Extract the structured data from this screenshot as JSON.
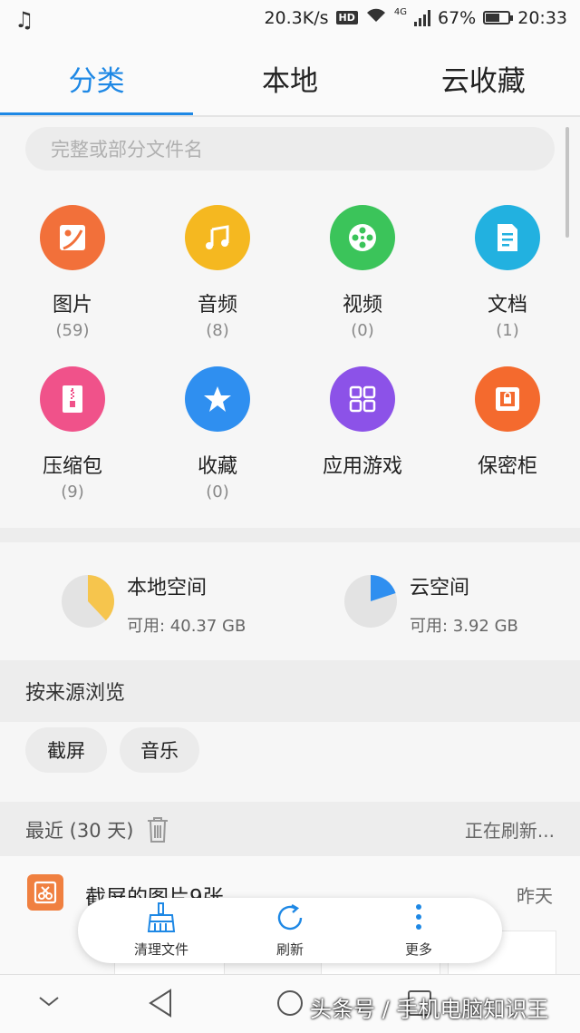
{
  "status_bar": {
    "speed": "20.3K/s",
    "hd": "HD",
    "network": "4G",
    "battery_pct": "67%",
    "battery_level": 0.67,
    "time": "20:33",
    "music_icon": "music-note-icon"
  },
  "tabs": [
    {
      "label": "分类",
      "active": true
    },
    {
      "label": "本地",
      "active": false
    },
    {
      "label": "云收藏",
      "active": false
    }
  ],
  "search": {
    "placeholder": "完整或部分文件名"
  },
  "categories": [
    {
      "label": "图片",
      "count": "(59)",
      "color": "#f2703a",
      "icon": "image-icon"
    },
    {
      "label": "音频",
      "count": "(8)",
      "color": "#f5b820",
      "icon": "music-icon"
    },
    {
      "label": "视频",
      "count": "(0)",
      "color": "#3bc45a",
      "icon": "film-reel-icon"
    },
    {
      "label": "文档",
      "count": "(1)",
      "color": "#22b1e0",
      "icon": "document-icon"
    },
    {
      "label": "压缩包",
      "count": "(9)",
      "color": "#f0528a",
      "icon": "zip-icon"
    },
    {
      "label": "收藏",
      "count": "(0)",
      "color": "#2f8ff0",
      "icon": "star-icon"
    },
    {
      "label": "应用游戏",
      "count": "",
      "color": "#8c52e8",
      "icon": "apps-grid-icon"
    },
    {
      "label": "保密柜",
      "count": "",
      "color": "#f46a2e",
      "icon": "safe-icon"
    }
  ],
  "storage": {
    "local": {
      "label": "本地空间",
      "available": "可用: 40.37 GB",
      "used_fraction": 0.38,
      "color": "#f6c54d"
    },
    "cloud": {
      "label": "云空间",
      "available": "可用: 3.92 GB",
      "used_fraction": 0.2,
      "color": "#2f8ff0"
    }
  },
  "source_browse": {
    "title": "按来源浏览",
    "chips": [
      "截屏",
      "音乐"
    ]
  },
  "recent": {
    "title": "最近 (30 天)",
    "status": "正在刷新...",
    "items": [
      {
        "title": "截屏的图片9张",
        "date": "昨天"
      }
    ]
  },
  "toolbar": {
    "clean": "清理文件",
    "refresh": "刷新",
    "more": "更多"
  },
  "watermark": "头条号 / 手机电脑知识王",
  "colors": {
    "accent": "#1e88e5"
  }
}
